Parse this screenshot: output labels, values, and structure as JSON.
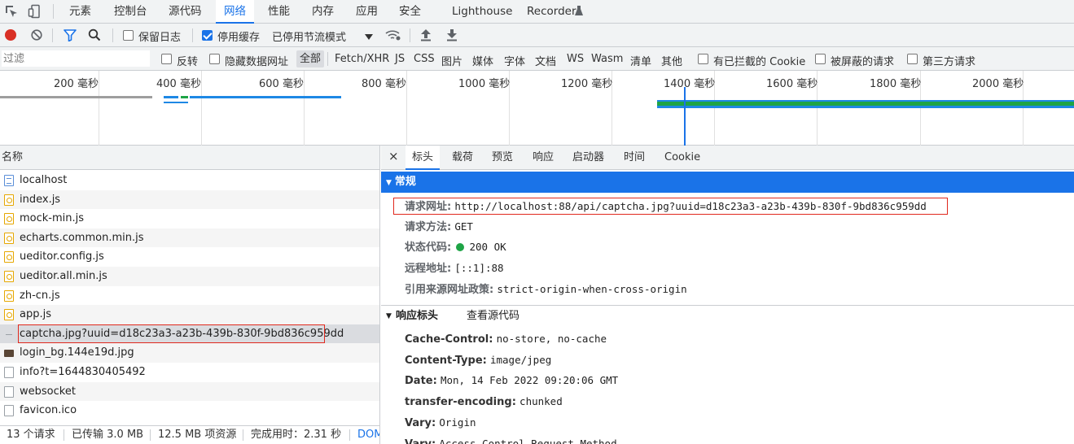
{
  "tabs": [
    "元素",
    "控制台",
    "源代码",
    "网络",
    "性能",
    "内存",
    "应用",
    "安全",
    "Lighthouse",
    "Recorder"
  ],
  "toolbar": {
    "preserve_log": "保留日志",
    "disable_cache": "停用缓存",
    "throttle": "已停用节流模式"
  },
  "filterbar": {
    "placeholder": "过滤",
    "invert": "反转",
    "hide_data_urls": "隐藏数据网址",
    "types": [
      "全部",
      "Fetch/XHR",
      "JS",
      "CSS",
      "图片",
      "媒体",
      "字体",
      "文档",
      "WS",
      "Wasm",
      "清单",
      "其他"
    ],
    "blocked_cookies": "有已拦截的 Cookie",
    "blocked_requests": "被屏蔽的请求",
    "third_party": "第三方请求"
  },
  "overview": {
    "ticks": [
      "200 毫秒",
      "400 毫秒",
      "600 毫秒",
      "800 毫秒",
      "1000 毫秒",
      "1200 毫秒",
      "1400 毫秒",
      "1600 毫秒",
      "1800 毫秒",
      "2000 毫秒"
    ]
  },
  "requests": {
    "column_name": "名称",
    "items": [
      {
        "name": "localhost",
        "icon": "doc-icon"
      },
      {
        "name": "index.js",
        "icon": "js-icon"
      },
      {
        "name": "mock-min.js",
        "icon": "js-icon"
      },
      {
        "name": "echarts.common.min.js",
        "icon": "js-icon"
      },
      {
        "name": "ueditor.config.js",
        "icon": "js-icon"
      },
      {
        "name": "ueditor.all.min.js",
        "icon": "js-icon"
      },
      {
        "name": "zh-cn.js",
        "icon": "js-icon"
      },
      {
        "name": "app.js",
        "icon": "js-icon"
      },
      {
        "name": "captcha.jpg?uuid=d18c23a3-a23b-439b-830f-9bd836c959dd",
        "icon": "dash-icon"
      },
      {
        "name": "login_bg.144e19d.jpg",
        "icon": "image-icon"
      },
      {
        "name": "info?t=1644830405492",
        "icon": "blank-icon"
      },
      {
        "name": "websocket",
        "icon": "blank-icon"
      },
      {
        "name": "favicon.ico",
        "icon": "blank-icon"
      }
    ]
  },
  "status": {
    "requests": "13 个请求",
    "transferred": "已传输 3.0 MB",
    "resources": "12.5 MB 项资源",
    "finish": "完成用时：2.31 秒",
    "dom": "DOM"
  },
  "details": {
    "tabs": [
      "标头",
      "载荷",
      "预览",
      "响应",
      "启动器",
      "时间",
      "Cookie"
    ],
    "general_title": "常规",
    "general": {
      "url_key": "请求网址:",
      "url_val": "http://localhost:88/api/captcha.jpg?uuid=d18c23a3-a23b-439b-830f-9bd836c959dd",
      "method_key": "请求方法:",
      "method_val": "GET",
      "status_key": "状态代码:",
      "status_val": "200 OK",
      "remote_key": "远程地址:",
      "remote_val": "[::1]:88",
      "referrer_key": "引用来源网址政策:",
      "referrer_val": "strict-origin-when-cross-origin"
    },
    "response_headers_title": "响应标头",
    "view_source": "查看源代码",
    "response_headers": [
      {
        "k": "Cache-Control:",
        "v": "no-store, no-cache"
      },
      {
        "k": "Content-Type:",
        "v": "image/jpeg"
      },
      {
        "k": "Date:",
        "v": "Mon, 14 Feb 2022 09:20:06 GMT"
      },
      {
        "k": "transfer-encoding:",
        "v": "chunked"
      },
      {
        "k": "Vary:",
        "v": "Origin"
      },
      {
        "k": "Vary:",
        "v": "Access-Control-Request-Method"
      }
    ]
  },
  "colors": {
    "accent": "#1a73e8",
    "record": "#d93025",
    "status_ok": "#1ea446",
    "highlight": "#e0281d"
  }
}
